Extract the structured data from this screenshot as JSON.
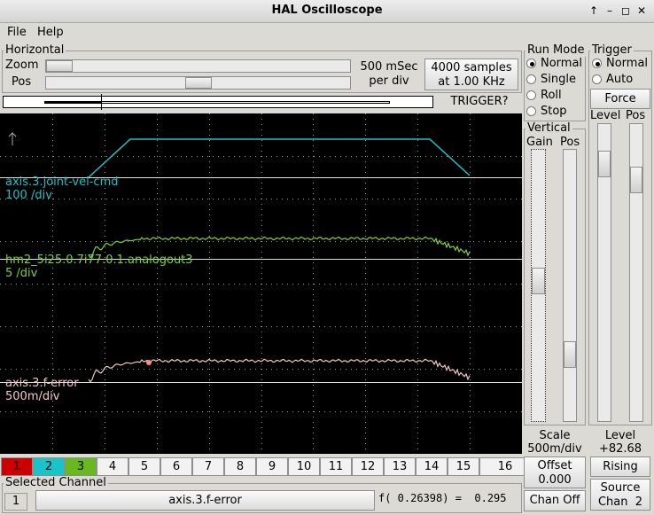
{
  "window": {
    "title": "HAL Oscilloscope",
    "ctrl_up": "↑",
    "ctrl_min": "–",
    "ctrl_max": "◻",
    "ctrl_close": "✕"
  },
  "menu": {
    "file": "File",
    "help": "Help"
  },
  "horizontal": {
    "title": "Horizontal",
    "zoom_label": "Zoom",
    "pos_label": "Pos",
    "zoom_level": 0.0,
    "pos_level": 0.55,
    "rate_line1": "500 mSec",
    "rate_line2": "per div",
    "samples_line1": "4000 samples",
    "samples_line2": "at 1.00 KHz",
    "trigger_status": "TRIGGER?"
  },
  "run_mode": {
    "title": "Run Mode",
    "options": [
      "Normal",
      "Single",
      "Roll",
      "Stop"
    ],
    "selected": "Normal"
  },
  "trigger": {
    "title": "Trigger",
    "options": [
      "Normal",
      "Auto"
    ],
    "selected": "Normal",
    "force_label": "Force",
    "level_label": "Level",
    "pos_label": "Pos",
    "level_readout_label": "Level",
    "level_value": "+82.68",
    "edge_label": "Rising",
    "source_line1": "Source",
    "source_line2": "Chan  2"
  },
  "vertical": {
    "title": "Vertical",
    "gain_label": "Gain",
    "pos_label": "Pos",
    "scale_label": "Scale",
    "scale_value": "500m/div",
    "offset_label": "Offset",
    "offset_value": "0.000",
    "chan_off_label": "Chan Off"
  },
  "traces": [
    {
      "name": "axis.3.joint-vel-cmd",
      "scale": "100 /div",
      "color": "#20c0c8"
    },
    {
      "name": "hm2_5i25.0.7i77.0.1.analogout3",
      "scale": "5 /div",
      "color": "#7dd13a"
    },
    {
      "name": "axis.3.f-error",
      "scale": "500m/div",
      "color": "#f0c8c8"
    }
  ],
  "channels": [
    {
      "label": "1",
      "color": "#cc0000"
    },
    {
      "label": "2",
      "color": "#19c3c8"
    },
    {
      "label": "3",
      "color": "#68b820"
    },
    {
      "label": "4"
    },
    {
      "label": "5"
    },
    {
      "label": "6"
    },
    {
      "label": "7"
    },
    {
      "label": "8"
    },
    {
      "label": "9"
    },
    {
      "label": "10"
    },
    {
      "label": "11"
    },
    {
      "label": "12"
    },
    {
      "label": "13"
    },
    {
      "label": "14"
    },
    {
      "label": "15"
    },
    {
      "label": "16"
    }
  ],
  "selected_channel": {
    "title": "Selected Channel",
    "number": "1",
    "name": "axis.3.f-error",
    "readout": "f( 0.26398) =  0.295"
  }
}
